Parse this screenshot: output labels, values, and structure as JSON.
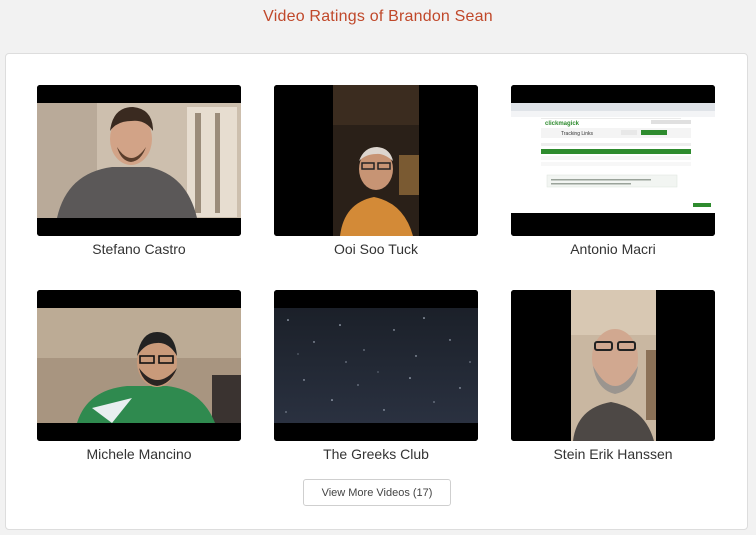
{
  "page": {
    "title": "Video Ratings of Brandon Sean"
  },
  "videos": [
    {
      "name": "Stefano Castro",
      "thumbnail": "man-in-room-webcam"
    },
    {
      "name": "Ooi Soo Tuck",
      "thumbnail": "man-vertical-video"
    },
    {
      "name": "Antonio Macri",
      "thumbnail": "screen-recording-clickmagick"
    },
    {
      "name": "Michele Mancino",
      "thumbnail": "man-green-shirt-webcam"
    },
    {
      "name": "The Greeks Club",
      "thumbnail": "dark-starfield"
    },
    {
      "name": "Stein Erik Hanssen",
      "thumbnail": "bearded-man-vertical-video"
    }
  ],
  "screen_recording": {
    "logo_text": "clickmagick",
    "heading": "Tracking Links"
  },
  "view_more": {
    "label": "View More Videos (17)"
  },
  "colors": {
    "title": "#c0482a",
    "accent_green": "#2e8b2e"
  }
}
